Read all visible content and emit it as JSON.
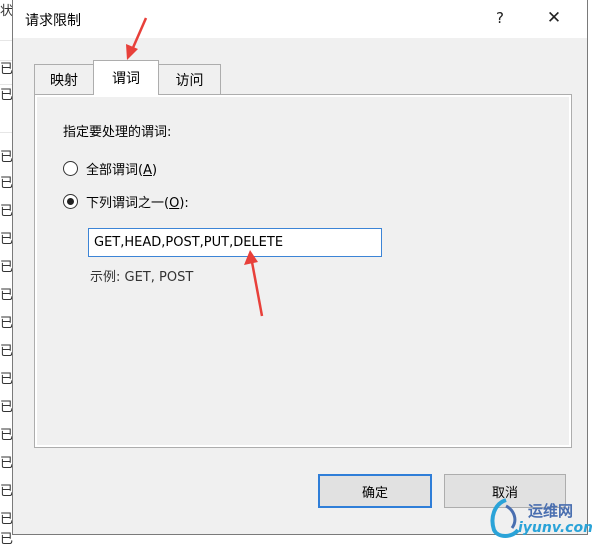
{
  "background_window": {
    "title_fragment": "状",
    "row_char": "已",
    "bottom_char": "已"
  },
  "dialog": {
    "title": "请求限制",
    "help_glyph": "?",
    "close_glyph": "✕"
  },
  "tabs": [
    {
      "label": "映射",
      "selected": false
    },
    {
      "label": "谓词",
      "selected": true
    },
    {
      "label": "访问",
      "selected": false
    }
  ],
  "verbs": {
    "instruction": "指定要处理的谓词:",
    "option_all": {
      "label": "全部谓词(",
      "hotkey": "A",
      "suffix": ")",
      "checked": false
    },
    "option_some": {
      "label": "下列谓词之一(",
      "hotkey": "O",
      "suffix": "):",
      "checked": true
    },
    "value": "GET,HEAD,POST,PUT,DELETE",
    "example": "示例: GET, POST"
  },
  "buttons": {
    "ok": "确定",
    "cancel": "取消"
  },
  "watermark": {
    "top": "运维网",
    "bottom": "iyunv.com"
  },
  "colors": {
    "annotation": "#e8403a",
    "focus_border": "#2f7ed8"
  }
}
